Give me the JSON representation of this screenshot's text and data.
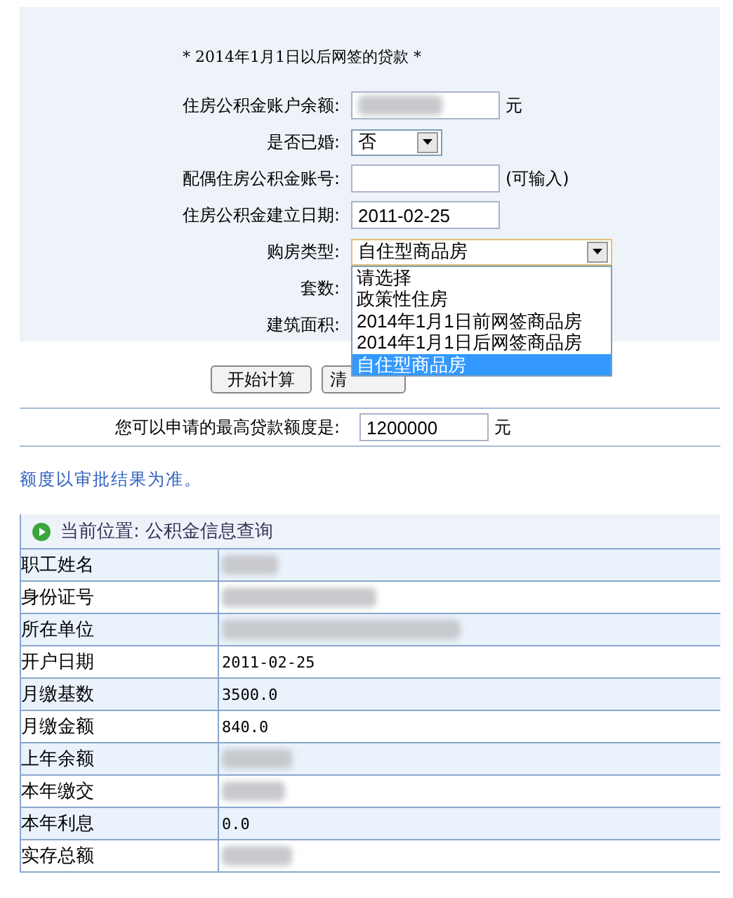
{
  "calculator": {
    "title": "* 2014年1月1日以后网签的贷款 *",
    "fields": [
      {
        "kind": "text",
        "label": "住房公积金账户余额:",
        "blurred": true,
        "unit": "元"
      },
      {
        "kind": "select",
        "label": "是否已婚:",
        "value": "否"
      },
      {
        "kind": "text",
        "label": "配偶住房公积金账号:",
        "unit": "(可输入)"
      },
      {
        "kind": "text",
        "label": "住房公积金建立日期:",
        "value": "2011-02-25"
      },
      {
        "kind": "open_select",
        "label": "购房类型:",
        "value": "自住型商品房",
        "options": [
          {
            "label": "请选择",
            "selected": false
          },
          {
            "label": "政策性住房",
            "selected": false
          },
          {
            "label": "2014年1月1日前网签商品房",
            "selected": false
          },
          {
            "label": "2014年1月1日后网签商品房",
            "selected": false
          },
          {
            "label": "自住型商品房",
            "selected": true
          }
        ]
      },
      {
        "kind": "hidden",
        "label": "套数:"
      },
      {
        "kind": "hidden",
        "label": "建筑面积:"
      }
    ],
    "buttons": [
      "开始计算",
      "清"
    ],
    "result": {
      "label": "您可以申请的最高贷款额度是:",
      "value": "1200000",
      "unit": "元"
    },
    "note": "额度以审批结果为准。"
  },
  "info": {
    "breadcrumb": "当前位置: 公积金信息查询",
    "rows": [
      {
        "label": "职工姓名",
        "blurred": true
      },
      {
        "label": "身份证号",
        "blurred": true
      },
      {
        "label": "所在单位",
        "blurred": true
      },
      {
        "label": "开户日期",
        "value": "2011-02-25",
        "blurred": false
      },
      {
        "label": "月缴基数",
        "value": "3500.0",
        "blurred": false
      },
      {
        "label": "月缴金额",
        "value": "840.0",
        "blurred": false
      },
      {
        "label": "上年余额",
        "blurred": true
      },
      {
        "label": "本年缴交",
        "blurred": true
      },
      {
        "label": "本年利息",
        "value": "0.0",
        "blurred": false
      },
      {
        "label": "实存总额",
        "blurred": true
      }
    ]
  }
}
